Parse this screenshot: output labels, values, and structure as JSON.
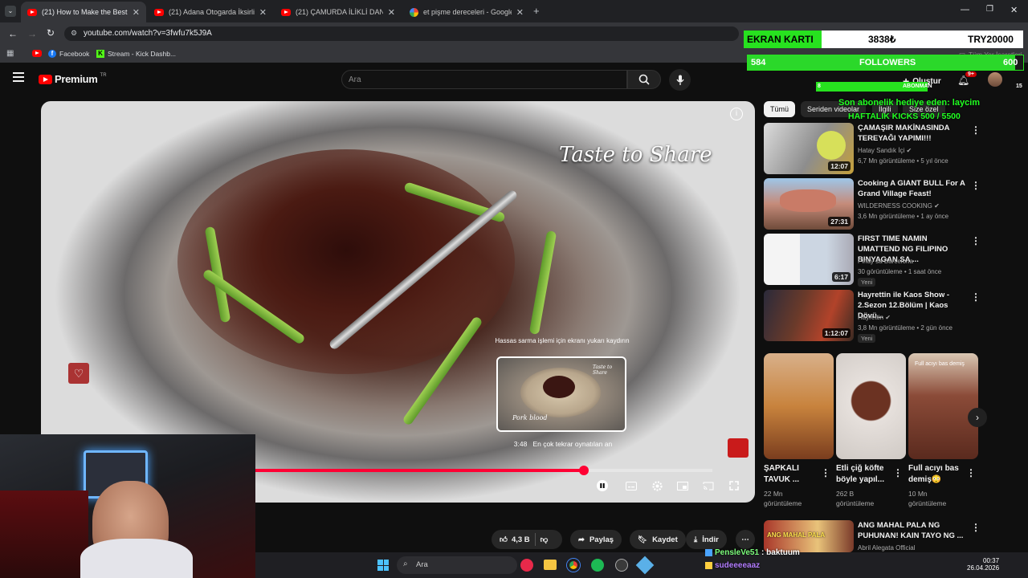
{
  "browser": {
    "tabs": [
      {
        "title": "(21) How to Make the Best Pork",
        "icon": "youtube-icon",
        "active": true
      },
      {
        "title": "(21) Adana Otogarda İksirli Ayr",
        "icon": "youtube-icon",
        "active": false
      },
      {
        "title": "(21) ÇAMURDA İLİKLİ DANA İN",
        "icon": "youtube-icon",
        "active": false
      },
      {
        "title": "et pişme dereceleri - Google'da",
        "icon": "google-icon",
        "active": false
      }
    ],
    "url": "youtube.com/watch?v=3fwfu7k5J9A",
    "bookmarks": [
      "Facebook",
      "Stream - Kick Dashb..."
    ],
    "all_bookmarks": "Tüm Yer İşaretleri"
  },
  "youtube": {
    "logo": "Premium",
    "region": "TR",
    "search_placeholder": "Ara",
    "create_label": "Oluştur",
    "notifications_badge": "9+"
  },
  "player": {
    "brand_overlay": "Taste to Share",
    "preview_brand": "Taste to Share",
    "preview_label": "Pork blood",
    "fine_seek_hint": "Hassas sarma işlemi için ekranı yukarı kaydırın",
    "preview_time": "3:48",
    "preview_caption": "En çok tekrar oynatılan an",
    "progress": 0.72
  },
  "actions": {
    "likes": "4,3 B",
    "share": "Paylaş",
    "save": "Kaydet",
    "download": "İndir"
  },
  "sidebar": {
    "chips": [
      "Tümü",
      "Seriden videolar",
      "İlgili",
      "Size özel"
    ],
    "videos": [
      {
        "title": "ÇAMAŞIR MAKİNASINDA TEREYAĞI YAPIMI!!!",
        "channel": "Hatay Sandık İçi",
        "verified": true,
        "meta": "6,7 Mn görüntüleme • 5 yıl önce",
        "duration": "12:07",
        "badge": ""
      },
      {
        "title": "Cooking A GIANT BULL For A Grand Village Feast!",
        "channel": "WILDERNESS COOKING",
        "verified": true,
        "meta": "3,6 Mn görüntüleme • 1 ay önce",
        "duration": "27:31",
        "badge": ""
      },
      {
        "title": "FIRST TIME NAMIN UMATTEND NG FILIPINO BINYAGAN SA ...",
        "channel": "Pinay sa Barcelona",
        "verified": false,
        "meta": "30 görüntüleme • 1 saat önce",
        "duration": "6:17",
        "badge": "Yeni"
      },
      {
        "title": "Hayrettin ile Kaos Show - 2.Sezon 12.Bölüm | Kaos Dövü...",
        "channel": "Hayrettin",
        "verified": true,
        "meta": "3,8 Mn görüntüleme • 2 gün önce",
        "duration": "1:12:07",
        "badge": "Yeni"
      }
    ],
    "shorts": [
      {
        "title": "ŞAPKALI TAVUK ...",
        "views": "22 Mn görüntüleme"
      },
      {
        "title": "Etli çiğ köfte böyle yapıl...",
        "views": "262 B görüntüleme"
      },
      {
        "title": "Full acıyı bas demiş😳",
        "views": "10 Mn görüntüleme"
      }
    ],
    "short_thumb_text": "Full acıyı bas demiş",
    "bottom_video": {
      "title": "ANG MAHAL PALA NG PUHUNAN! KAIN TAYO NG ...",
      "channel": "Abril Alegata Official",
      "thumb_text": "ANG MAHAL PALA"
    }
  },
  "overlays": {
    "gpu_name": "EKRAN KARTI",
    "gpu_current": "3838₺",
    "gpu_target": "TRY20000",
    "gpu_progress": 0.19,
    "followers_current": "584",
    "followers_label": "FOLLOWERS",
    "followers_target": "600",
    "followers_progress": 0.97,
    "subs_current": "8",
    "subs_label": "ABONMAN",
    "subs_target": "15",
    "subs_progress": 0.53,
    "last_gift": "Son abonelik hediye eden: laycim",
    "weekly_kicks": "HAFTALIK KICKS 500 / 5500",
    "chat_user": "PensleVe51",
    "chat_message": ": baktuum",
    "chat_user2": "sudeeeeaaz"
  },
  "taskbar": {
    "search_placeholder": "Ara",
    "time": "00:37",
    "date": "26.04.2026"
  },
  "colors": {
    "youtube_red": "#ff0000",
    "progress_red": "#ff0033",
    "overlay_green": "#27e21f"
  }
}
